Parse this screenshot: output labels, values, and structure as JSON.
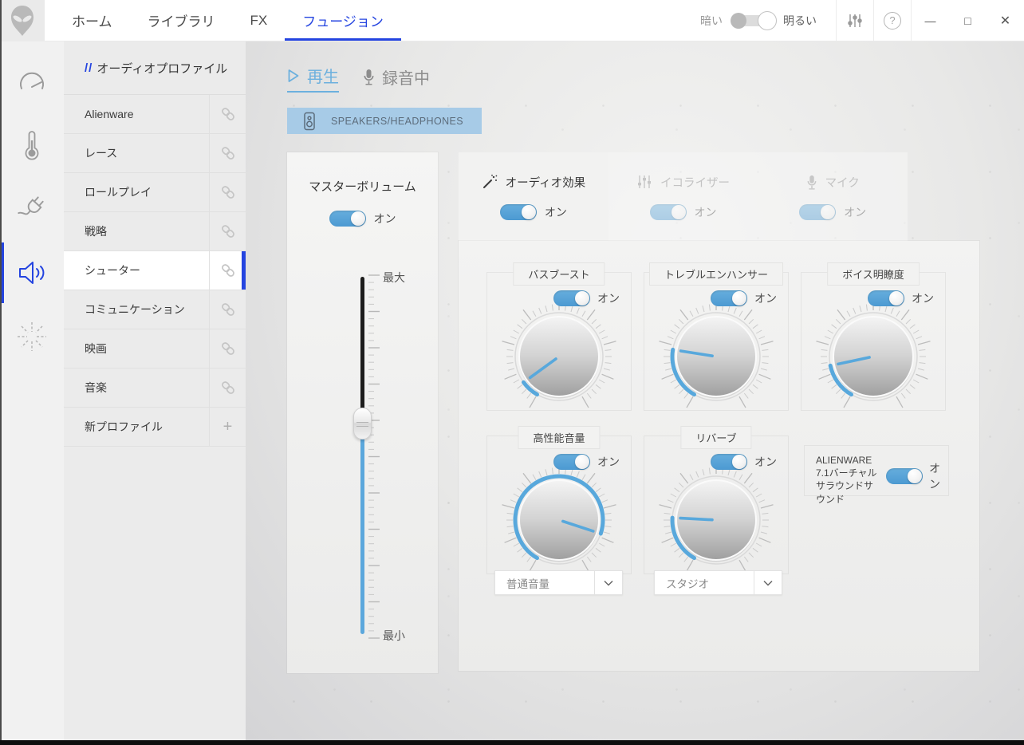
{
  "labels": {
    "on": "オン"
  },
  "colors": {
    "accent_blue": "#2444e0",
    "light_blue": "#5ba7dc",
    "device_button_bg": "#a7cbe7"
  },
  "icons": {
    "minimize": "—",
    "maximize": "□",
    "close": "✕",
    "plus": "+",
    "help": "?"
  },
  "titlebar": {
    "nav": [
      {
        "label": "ホーム"
      },
      {
        "label": "ライブラリ"
      },
      {
        "label": "FX"
      },
      {
        "label": "フュージョン",
        "active": true
      }
    ],
    "theme": {
      "dark_label": "暗い",
      "light_label": "明るい",
      "state": "light"
    }
  },
  "sidebar": {
    "header_slashes": "//",
    "header_label": "オーディオプロファイル",
    "items": [
      {
        "label": "Alienware",
        "icon": "link"
      },
      {
        "label": "レース",
        "icon": "link"
      },
      {
        "label": "ロールプレイ",
        "icon": "link"
      },
      {
        "label": "戦略",
        "icon": "link"
      },
      {
        "label": "シューター",
        "icon": "link",
        "selected": true
      },
      {
        "label": "コミュニケーション",
        "icon": "link"
      },
      {
        "label": "映画",
        "icon": "link"
      },
      {
        "label": "音楽",
        "icon": "link"
      },
      {
        "label": "新プロファイル",
        "icon": "plus"
      }
    ]
  },
  "content": {
    "device_tabs": [
      {
        "label": "再生",
        "active": true
      },
      {
        "label": "録音中",
        "active": false
      }
    ],
    "device_button": "SPEAKERS/HEADPHONES",
    "master": {
      "title": "マスターボリューム",
      "toggle": "オン",
      "max_label": "最大",
      "min_label": "最小",
      "thumb_fraction_from_top": 0.41
    },
    "effect_tabs": [
      {
        "label": "オーディオ効果",
        "toggle": "オン",
        "active": true
      },
      {
        "label": "イコライザー",
        "toggle": "オン",
        "active": false
      },
      {
        "label": "マイク",
        "toggle": "オン",
        "active": false
      }
    ],
    "knobs": [
      {
        "label": "バスブースト",
        "toggle": "オン",
        "value_fraction": 0.08
      },
      {
        "label": "トレブルエンハンサー",
        "toggle": "オン",
        "value_fraction": 0.23
      },
      {
        "label": "ボイス明瞭度",
        "toggle": "オン",
        "value_fraction": 0.16
      },
      {
        "label": "高性能音量",
        "toggle": "オン",
        "value_fraction": 0.86,
        "dropdown_value": "普通音量"
      },
      {
        "label": "リバーブ",
        "toggle": "オン",
        "value_fraction": 0.21,
        "dropdown_value": "スタジオ"
      }
    ],
    "surround": {
      "label": "ALIENWARE 7.1バーチャルサラウンドサウンド",
      "toggle": "オン"
    }
  }
}
